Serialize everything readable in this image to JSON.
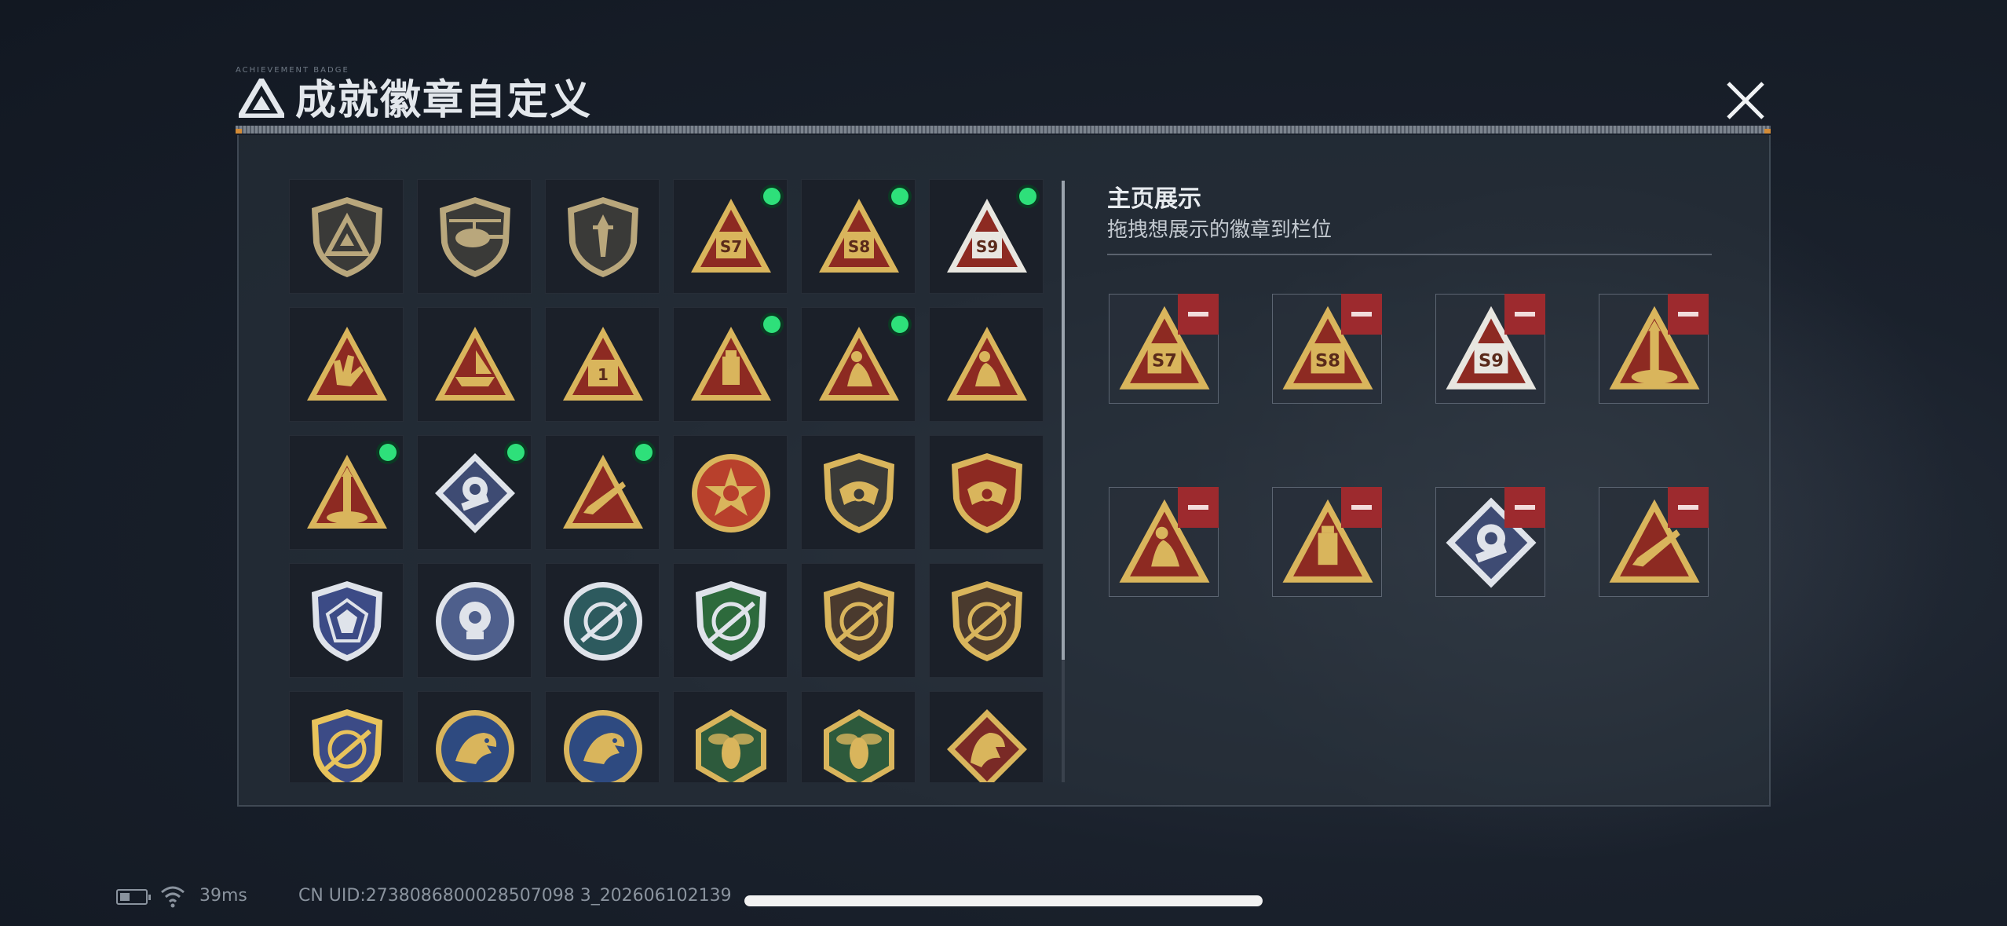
{
  "window": {
    "title": "成就徽章自定义",
    "title_small": "ACHIEVEMENT BADGE"
  },
  "badges": [
    {
      "shape": "shield",
      "fill": "#3a3a38",
      "accent": "#b9a77c",
      "glyph": "logo",
      "new": false
    },
    {
      "shape": "shield",
      "fill": "#3a3a38",
      "accent": "#b9a77c",
      "glyph": "heli",
      "new": false
    },
    {
      "shape": "shield",
      "fill": "#3a3a38",
      "accent": "#b9a77c",
      "glyph": "dagger",
      "new": false
    },
    {
      "shape": "triangle",
      "fill": "#8d2a22",
      "accent": "#d9b55c",
      "glyph": "text",
      "text": "S7",
      "new": true
    },
    {
      "shape": "triangle",
      "fill": "#8d2a22",
      "accent": "#d9b55c",
      "glyph": "text",
      "text": "S8",
      "new": true
    },
    {
      "shape": "triangle",
      "fill": "#8d2a22",
      "accent": "#e8e6e0",
      "glyph": "text",
      "text": "S9",
      "new": true
    },
    {
      "shape": "triangle",
      "fill": "#8d2a22",
      "accent": "#d9b55c",
      "glyph": "hand",
      "new": false
    },
    {
      "shape": "triangle",
      "fill": "#8d2a22",
      "accent": "#d9b55c",
      "glyph": "boat",
      "new": false
    },
    {
      "shape": "triangle",
      "fill": "#8d2a22",
      "accent": "#d9b55c",
      "glyph": "text",
      "text": "1",
      "new": false
    },
    {
      "shape": "triangle",
      "fill": "#8d2a22",
      "accent": "#d9b55c",
      "glyph": "box",
      "new": true
    },
    {
      "shape": "triangle",
      "fill": "#8d2a22",
      "accent": "#d9b55c",
      "glyph": "figure",
      "new": true
    },
    {
      "shape": "triangle",
      "fill": "#8d2a22",
      "accent": "#d9b55c",
      "glyph": "figure",
      "new": false
    },
    {
      "shape": "triangle",
      "fill": "#8d2a22",
      "accent": "#d9b55c",
      "glyph": "rocket",
      "new": true
    },
    {
      "shape": "diamond",
      "fill": "#3e4b73",
      "accent": "#dfe3ea",
      "glyph": "flower",
      "new": true
    },
    {
      "shape": "triangle",
      "fill": "#8d2a22",
      "accent": "#d9b55c",
      "glyph": "gun",
      "new": true
    },
    {
      "shape": "circle",
      "fill": "#b8402c",
      "accent": "#d9b55c",
      "glyph": "star",
      "new": false
    },
    {
      "shape": "shield",
      "fill": "#3a3a38",
      "accent": "#d9b55c",
      "glyph": "wing",
      "new": false
    },
    {
      "shape": "shield",
      "fill": "#8d2a22",
      "accent": "#d9b55c",
      "glyph": "wing",
      "new": false
    },
    {
      "shape": "shield",
      "fill": "#3c4b86",
      "accent": "#dfe3ea",
      "glyph": "gem",
      "new": false
    },
    {
      "shape": "circle",
      "fill": "#4e5f8c",
      "accent": "#dfe3ea",
      "glyph": "skull",
      "new": false
    },
    {
      "shape": "circle",
      "fill": "#2d5a5e",
      "accent": "#dfe3ea",
      "glyph": "scope",
      "new": false
    },
    {
      "shape": "shield",
      "fill": "#2d6a3c",
      "accent": "#dfe3ea",
      "glyph": "scope",
      "new": false
    },
    {
      "shape": "shield",
      "fill": "#4a3a2e",
      "accent": "#d9b55c",
      "glyph": "scope",
      "new": false
    },
    {
      "shape": "shield",
      "fill": "#4a3a2e",
      "accent": "#d9b55c",
      "glyph": "scope",
      "new": false
    },
    {
      "shape": "shield",
      "fill": "#3c4b86",
      "accent": "#e8c35c",
      "glyph": "scope",
      "new": false
    },
    {
      "shape": "circle",
      "fill": "#2e4a80",
      "accent": "#d9b55c",
      "glyph": "eagle",
      "new": false
    },
    {
      "shape": "circle",
      "fill": "#2e4a80",
      "accent": "#d9b55c",
      "glyph": "eagle",
      "new": false
    },
    {
      "shape": "hexagon",
      "fill": "#2d5a3c",
      "accent": "#d9b55c",
      "glyph": "bee",
      "new": false
    },
    {
      "shape": "hexagon",
      "fill": "#2d5a3c",
      "accent": "#d9b55c",
      "glyph": "bee",
      "new": false
    },
    {
      "shape": "diamond",
      "fill": "#7a2a26",
      "accent": "#d9b55c",
      "glyph": "dragon",
      "new": false
    }
  ],
  "showcase": {
    "title": "主页展示",
    "subtitle": "拖拽想展示的徽章到栏位",
    "slots": [
      {
        "shape": "triangle",
        "fill": "#8d2a22",
        "accent": "#d9b55c",
        "glyph": "text",
        "text": "S7"
      },
      {
        "shape": "triangle",
        "fill": "#8d2a22",
        "accent": "#d9b55c",
        "glyph": "text",
        "text": "S8"
      },
      {
        "shape": "triangle",
        "fill": "#8d2a22",
        "accent": "#e8e6e0",
        "glyph": "text",
        "text": "S9"
      },
      {
        "shape": "triangle",
        "fill": "#8d2a22",
        "accent": "#d9b55c",
        "glyph": "rocket"
      },
      {
        "shape": "triangle",
        "fill": "#8d2a22",
        "accent": "#d9b55c",
        "glyph": "figure"
      },
      {
        "shape": "triangle",
        "fill": "#8d2a22",
        "accent": "#d9b55c",
        "glyph": "box"
      },
      {
        "shape": "diamond",
        "fill": "#3e4b73",
        "accent": "#dfe3ea",
        "glyph": "flower"
      },
      {
        "shape": "triangle",
        "fill": "#8d2a22",
        "accent": "#d9b55c",
        "glyph": "gun"
      }
    ]
  },
  "status": {
    "ping": "39ms",
    "uid": "CN UID:2738086800028507098 3_202606102139"
  },
  "colors": {
    "new_dot": "#2ee07a",
    "remove": "#9d2a2e",
    "accent_orange": "#d38b36"
  }
}
